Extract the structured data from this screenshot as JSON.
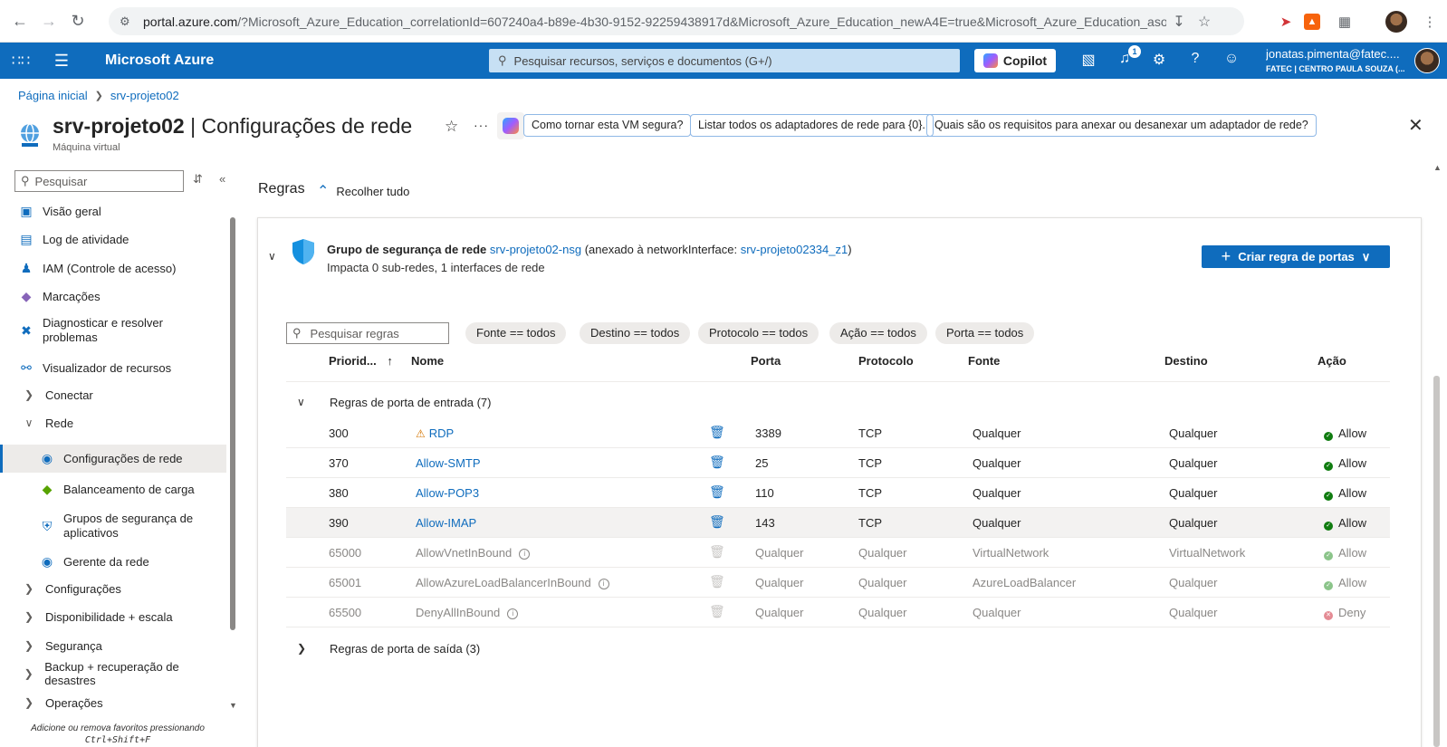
{
  "browser": {
    "url_host": "portal.azure.com",
    "url_rest": "/?Microsoft_Azure_Education_correlationId=607240a4-b89e-4b30-9152-92259438917d&Microsoft_Azure_Education_newA4E=true&Microsoft_Azure_Education_asoS..."
  },
  "topbar": {
    "brand": "Microsoft Azure",
    "search_placeholder": "Pesquisar recursos, serviços e documentos (G+/)",
    "copilot_label": "Copilot",
    "notifications_count": "1",
    "account_email": "jonatas.pimenta@fatec....",
    "account_org": "FATEC | CENTRO PAULA SOUZA (..."
  },
  "breadcrumb": {
    "home": "Página inicial",
    "current": "srv-projeto02"
  },
  "header": {
    "resource_name": "srv-projeto02",
    "page_name": "| Configurações de rede",
    "resource_type": "Máquina virtual",
    "suggestions": [
      "Como tornar esta VM segura?",
      "Listar todos os adaptadores de rede para {0}.",
      "Quais são os requisitos para anexar ou desanexar um adaptador de rede?"
    ]
  },
  "sidebar": {
    "search_placeholder": "Pesquisar",
    "items": [
      {
        "label": "Visão geral"
      },
      {
        "label": "Log de atividade"
      },
      {
        "label": "IAM (Controle de acesso)"
      },
      {
        "label": "Marcações"
      },
      {
        "label": "Diagnosticar e resolver problemas"
      },
      {
        "label": "Visualizador de recursos"
      },
      {
        "label": "Conectar"
      },
      {
        "label": "Rede"
      },
      {
        "label": "Configurações de rede"
      },
      {
        "label": "Balanceamento de carga"
      },
      {
        "label": "Grupos de segurança de aplicativos"
      },
      {
        "label": "Gerente da rede"
      },
      {
        "label": "Configurações"
      },
      {
        "label": "Disponibilidade + escala"
      },
      {
        "label": "Segurança"
      },
      {
        "label": "Backup + recuperação de desastres"
      },
      {
        "label": "Operações"
      }
    ],
    "favorites_hint_1": "Adicione ou remova favoritos pressionando",
    "favorites_hint_2": "Ctrl+Shift+F"
  },
  "main": {
    "section_label": "Regras",
    "collapse_all": "Recolher tudo",
    "nsg": {
      "prefix": "Grupo de segurança de rede",
      "name": "srv-projeto02-nsg",
      "attached_text": "(anexado à networkInterface:",
      "nic_name": "srv-projeto02334_z1",
      "close_paren": ")",
      "impact": "Impacta 0 sub-redes, 1 interfaces de rede"
    },
    "create_button": "Criar regra de portas",
    "rule_search_placeholder": "Pesquisar regras",
    "filters": [
      "Fonte == todos",
      "Destino == todos",
      "Protocolo == todos",
      "Ação == todos",
      "Porta == todos"
    ],
    "columns": {
      "priority": "Priorid...",
      "name": "Nome",
      "port": "Porta",
      "protocol": "Protocolo",
      "source": "Fonte",
      "destination": "Destino",
      "action": "Ação"
    },
    "inbound_group": "Regras de porta de entrada (7)",
    "outbound_group": "Regras de porta de saída (3)",
    "rules": [
      {
        "priority": "300",
        "name": "RDP",
        "port": "3389",
        "protocol": "TCP",
        "source": "Qualquer",
        "destination": "Qualquer",
        "action": "Allow"
      },
      {
        "priority": "370",
        "name": "Allow-SMTP",
        "port": "25",
        "protocol": "TCP",
        "source": "Qualquer",
        "destination": "Qualquer",
        "action": "Allow"
      },
      {
        "priority": "380",
        "name": "Allow-POP3",
        "port": "110",
        "protocol": "TCP",
        "source": "Qualquer",
        "destination": "Qualquer",
        "action": "Allow"
      },
      {
        "priority": "390",
        "name": "Allow-IMAP",
        "port": "143",
        "protocol": "TCP",
        "source": "Qualquer",
        "destination": "Qualquer",
        "action": "Allow"
      },
      {
        "priority": "65000",
        "name": "AllowVnetInBound",
        "port": "Qualquer",
        "protocol": "Qualquer",
        "source": "VirtualNetwork",
        "destination": "VirtualNetwork",
        "action": "Allow"
      },
      {
        "priority": "65001",
        "name": "AllowAzureLoadBalancerInBound",
        "port": "Qualquer",
        "protocol": "Qualquer",
        "source": "AzureLoadBalancer",
        "destination": "Qualquer",
        "action": "Allow"
      },
      {
        "priority": "65500",
        "name": "DenyAllInBound",
        "port": "Qualquer",
        "protocol": "Qualquer",
        "source": "Qualquer",
        "destination": "Qualquer",
        "action": "Deny"
      }
    ]
  }
}
